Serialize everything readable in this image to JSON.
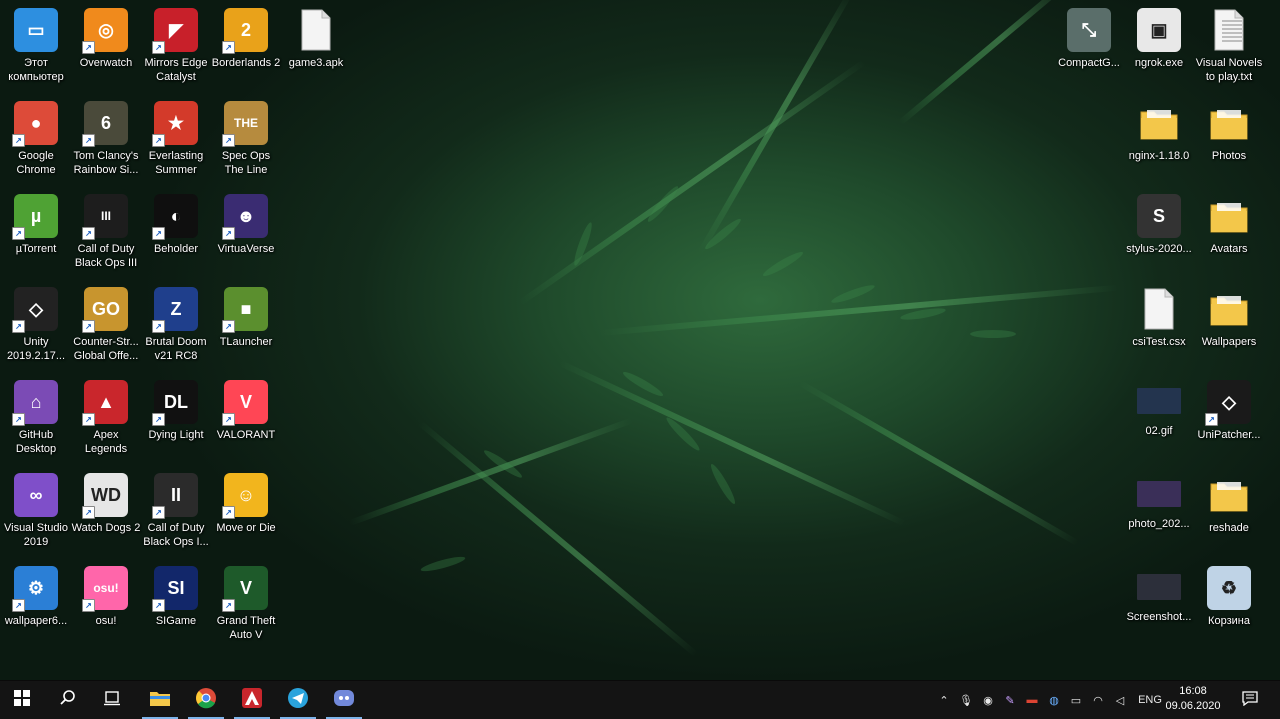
{
  "desktop_icons": [
    {
      "id": "this-pc",
      "label": "Этот компьютер",
      "icon": "computer-icon",
      "color": "#2d8fe0",
      "glyph": "▭",
      "shortcut": false
    },
    {
      "id": "overwatch",
      "label": "Overwatch",
      "icon": "overwatch-icon",
      "color": "#f08a1c",
      "glyph": "◎",
      "shortcut": true
    },
    {
      "id": "mirrors-edge",
      "label": "Mirrors Edge Catalyst",
      "icon": "mirrors-edge-icon",
      "color": "#c8202a",
      "glyph": "◤",
      "shortcut": true
    },
    {
      "id": "borderlands2",
      "label": "Borderlands 2",
      "icon": "borderlands2-icon",
      "color": "#e9a21a",
      "glyph": "2",
      "shortcut": true
    },
    {
      "id": "game3apk",
      "label": "game3.apk",
      "icon": "file-icon",
      "color": "#f4f4f4",
      "glyph": "",
      "shortcut": false
    },
    {
      "id": "chrome",
      "label": "Google Chrome",
      "icon": "chrome-icon",
      "color": "#dd4b39",
      "glyph": "●",
      "shortcut": true
    },
    {
      "id": "rainbow-six",
      "label": "Tom Clancy's Rainbow Si...",
      "icon": "rainbow-six-icon",
      "color": "#4a4a3a",
      "glyph": "6",
      "shortcut": true
    },
    {
      "id": "everlasting-summer",
      "label": "Everlasting Summer",
      "icon": "everlasting-summer-icon",
      "color": "#d33a2a",
      "glyph": "★",
      "shortcut": true
    },
    {
      "id": "spec-ops",
      "label": "Spec Ops The Line",
      "icon": "spec-ops-icon",
      "color": "#b68b3e",
      "glyph": "THE",
      "shortcut": true
    },
    {
      "id": "utorrent",
      "label": "µTorrent",
      "icon": "utorrent-icon",
      "color": "#4fa234",
      "glyph": "µ",
      "shortcut": true
    },
    {
      "id": "cod-bo3",
      "label": "Call of Duty Black Ops III",
      "icon": "cod-bo3-icon",
      "color": "#1d1d1d",
      "glyph": "III",
      "shortcut": true
    },
    {
      "id": "beholder",
      "label": "Beholder",
      "icon": "beholder-icon",
      "color": "#0f0f0f",
      "glyph": "◐",
      "shortcut": true
    },
    {
      "id": "virtuaverse",
      "label": "VirtuaVerse",
      "icon": "virtuaverse-icon",
      "color": "#3a2c72",
      "glyph": "☻",
      "shortcut": true
    },
    {
      "id": "unity",
      "label": "Unity 2019.2.17...",
      "icon": "unity-icon",
      "color": "#222222",
      "glyph": "◇",
      "shortcut": true
    },
    {
      "id": "csgo",
      "label": "Counter-Str... Global Offe...",
      "icon": "csgo-icon",
      "color": "#c8952e",
      "glyph": "GO",
      "shortcut": true
    },
    {
      "id": "brutal-doom",
      "label": "Brutal Doom v21 RC8",
      "icon": "brutal-doom-icon",
      "color": "#1f3f8c",
      "glyph": "Z",
      "shortcut": true
    },
    {
      "id": "tlauncher",
      "label": "TLauncher",
      "icon": "tlauncher-icon",
      "color": "#5b8f2e",
      "glyph": "■",
      "shortcut": true
    },
    {
      "id": "github-desktop",
      "label": "GitHub Desktop",
      "icon": "github-desktop-icon",
      "color": "#7b4bb5",
      "glyph": "⌂",
      "shortcut": true
    },
    {
      "id": "apex",
      "label": "Apex Legends",
      "icon": "apex-icon",
      "color": "#c9262c",
      "glyph": "▲",
      "shortcut": true
    },
    {
      "id": "dying-light",
      "label": "Dying Light",
      "icon": "dying-light-icon",
      "color": "#111111",
      "glyph": "DL",
      "shortcut": true
    },
    {
      "id": "valorant",
      "label": "VALORANT",
      "icon": "valorant-icon",
      "color": "#ff4655",
      "glyph": "V",
      "shortcut": true
    },
    {
      "id": "visual-studio",
      "label": "Visual Studio 2019",
      "icon": "visual-studio-icon",
      "color": "#7f4fc9",
      "glyph": "∞",
      "shortcut": false
    },
    {
      "id": "watch-dogs2",
      "label": "Watch Dogs 2",
      "icon": "watch-dogs2-icon",
      "color": "#e6e6e6",
      "glyph": "WD",
      "shortcut": true
    },
    {
      "id": "cod-bo",
      "label": "Call of Duty Black Ops I...",
      "icon": "cod-bo-icon",
      "color": "#2b2b2b",
      "glyph": "II",
      "shortcut": true
    },
    {
      "id": "move-or-die",
      "label": "Move or Die",
      "icon": "move-or-die-icon",
      "color": "#f2b51d",
      "glyph": "☺",
      "shortcut": true
    },
    {
      "id": "wallpaper6",
      "label": "wallpaper6...",
      "icon": "wallpaper-engine-icon",
      "color": "#2b7fd6",
      "glyph": "⚙",
      "shortcut": true
    },
    {
      "id": "osu",
      "label": "osu!",
      "icon": "osu-icon",
      "color": "#ff66aa",
      "glyph": "osu!",
      "shortcut": true
    },
    {
      "id": "sigame",
      "label": "SIGame",
      "icon": "sigame-icon",
      "color": "#12276a",
      "glyph": "SI",
      "shortcut": true
    },
    {
      "id": "gta5",
      "label": "Grand Theft Auto V",
      "icon": "gta5-icon",
      "color": "#1e5a2a",
      "glyph": "V",
      "shortcut": true
    },
    {
      "id": "compactgui",
      "label": "CompactG...",
      "icon": "compactgui-icon",
      "color": "#5a6e6a",
      "glyph": "⤡",
      "shortcut": false
    },
    {
      "id": "ngrok",
      "label": "ngrok.exe",
      "icon": "exe-icon",
      "color": "#e8e8e8",
      "glyph": "▣",
      "shortcut": false
    },
    {
      "id": "visual-novels",
      "label": "Visual Novels to play.txt",
      "icon": "text-file-icon",
      "color": "#f4f4f4",
      "glyph": "≡",
      "shortcut": false
    },
    {
      "id": "nginx",
      "label": "nginx-1.18.0",
      "icon": "folder-icon",
      "color": "#f3c74a",
      "glyph": "",
      "shortcut": false
    },
    {
      "id": "photos",
      "label": "Photos",
      "icon": "folder-icon",
      "color": "#f3c74a",
      "glyph": "",
      "shortcut": false
    },
    {
      "id": "stylus",
      "label": "stylus-2020...",
      "icon": "stylus-icon",
      "color": "#333333",
      "glyph": "S",
      "shortcut": false
    },
    {
      "id": "avatars",
      "label": "Avatars",
      "icon": "folder-icon",
      "color": "#f3c74a",
      "glyph": "",
      "shortcut": false
    },
    {
      "id": "csitest",
      "label": "csiTest.csx",
      "icon": "file-icon",
      "color": "#f4f4f4",
      "glyph": "",
      "shortcut": false
    },
    {
      "id": "wallpapers",
      "label": "Wallpapers",
      "icon": "folder-icon",
      "color": "#f3c74a",
      "glyph": "",
      "shortcut": false
    },
    {
      "id": "gif02",
      "label": "02.gif",
      "icon": "image-thumbnail-icon",
      "color": "#23344e",
      "glyph": "",
      "shortcut": false
    },
    {
      "id": "unipatcher",
      "label": "UniPatcher...",
      "icon": "unipatcher-icon",
      "color": "#1a1a1a",
      "glyph": "◇",
      "shortcut": true
    },
    {
      "id": "photo2020",
      "label": "photo_202...",
      "icon": "image-thumbnail-icon",
      "color": "#3a2f58",
      "glyph": "",
      "shortcut": false
    },
    {
      "id": "reshade",
      "label": "reshade",
      "icon": "folder-icon",
      "color": "#f3c74a",
      "glyph": "",
      "shortcut": false
    },
    {
      "id": "screenshot",
      "label": "Screenshot...",
      "icon": "image-thumbnail-icon",
      "color": "#2c2f3a",
      "glyph": "",
      "shortcut": false
    },
    {
      "id": "recycle-bin",
      "label": "Корзина",
      "icon": "recycle-bin-icon",
      "color": "#bfd3e6",
      "glyph": "♻",
      "shortcut": false
    }
  ],
  "taskbar": {
    "start": {
      "icon": "windows-start-icon"
    },
    "search": {
      "icon": "search-icon"
    },
    "task_view": {
      "icon": "task-view-icon"
    },
    "pinned": [
      {
        "id": "explorer",
        "icon": "file-explorer-icon",
        "color": "#f3c74a",
        "active": true
      },
      {
        "id": "chrome",
        "icon": "chrome-icon",
        "color": "#dd4b39",
        "active": true
      },
      {
        "id": "apex",
        "icon": "apex-icon",
        "color": "#c9262c",
        "active": true
      },
      {
        "id": "telegram",
        "icon": "telegram-icon",
        "color": "#2aa3dc",
        "active": true
      },
      {
        "id": "discord",
        "icon": "discord-icon",
        "color": "#7289da",
        "active": true
      }
    ],
    "tray": {
      "language": "ENG",
      "time": "16:08",
      "date": "09.06.2020",
      "icons": [
        "chevron-up-icon",
        "microphone-icon",
        "discord-tray-icon",
        "feather-icon",
        "flag-icon",
        "globe-icon",
        "battery-icon",
        "wifi-icon",
        "volume-icon"
      ]
    },
    "notifications": {
      "icon": "action-center-icon"
    }
  }
}
